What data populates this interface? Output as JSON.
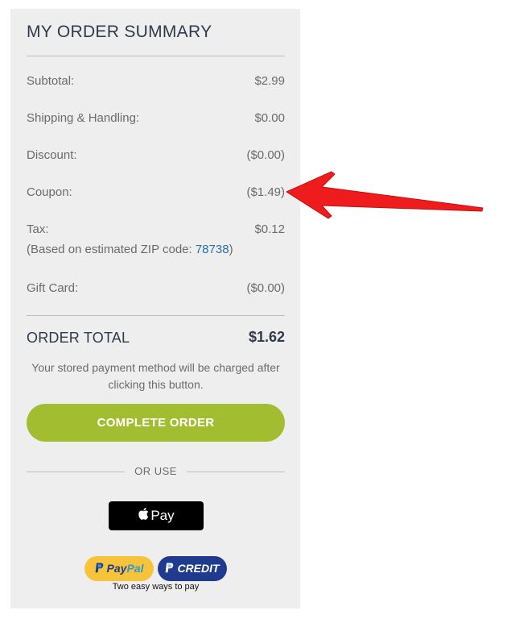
{
  "summary": {
    "title": "MY ORDER SUMMARY",
    "rows": [
      {
        "label": "Subtotal:",
        "value": "$2.99"
      },
      {
        "label": "Shipping & Handling:",
        "value": "$0.00"
      },
      {
        "label": "Discount:",
        "value": "($0.00)"
      },
      {
        "label": "Coupon:",
        "value": "($1.49)"
      },
      {
        "label": "Tax:",
        "value": "$0.12"
      },
      {
        "label": "Gift Card:",
        "value": "($0.00)"
      }
    ],
    "tax_note": {
      "prefix": "(Based on estimated ZIP code: ",
      "zip": "78738",
      "suffix": ")"
    },
    "total": {
      "label": "ORDER TOTAL",
      "value": "$1.62"
    },
    "payment_note": "Your stored payment method will be charged after clicking this button.",
    "complete_button": "COMPLETE ORDER",
    "or_use": "OR USE",
    "apple_pay": "Pay",
    "paypal": {
      "paypal_word1": "Pay",
      "paypal_word2": "Pal",
      "credit_word": "CREDIT",
      "tagline": "Two easy ways to pay"
    }
  },
  "colors": {
    "panel_bg": "#eeeeee",
    "cta": "#a3bd31",
    "link": "#2a6fa8",
    "annotation_arrow": "#ee1c1c",
    "paypal_yellow": "#f7c33a",
    "paypal_blue": "#1f3b8f"
  },
  "icons": [
    "apple-icon",
    "paypal-p-icon",
    "annotation-arrow"
  ]
}
